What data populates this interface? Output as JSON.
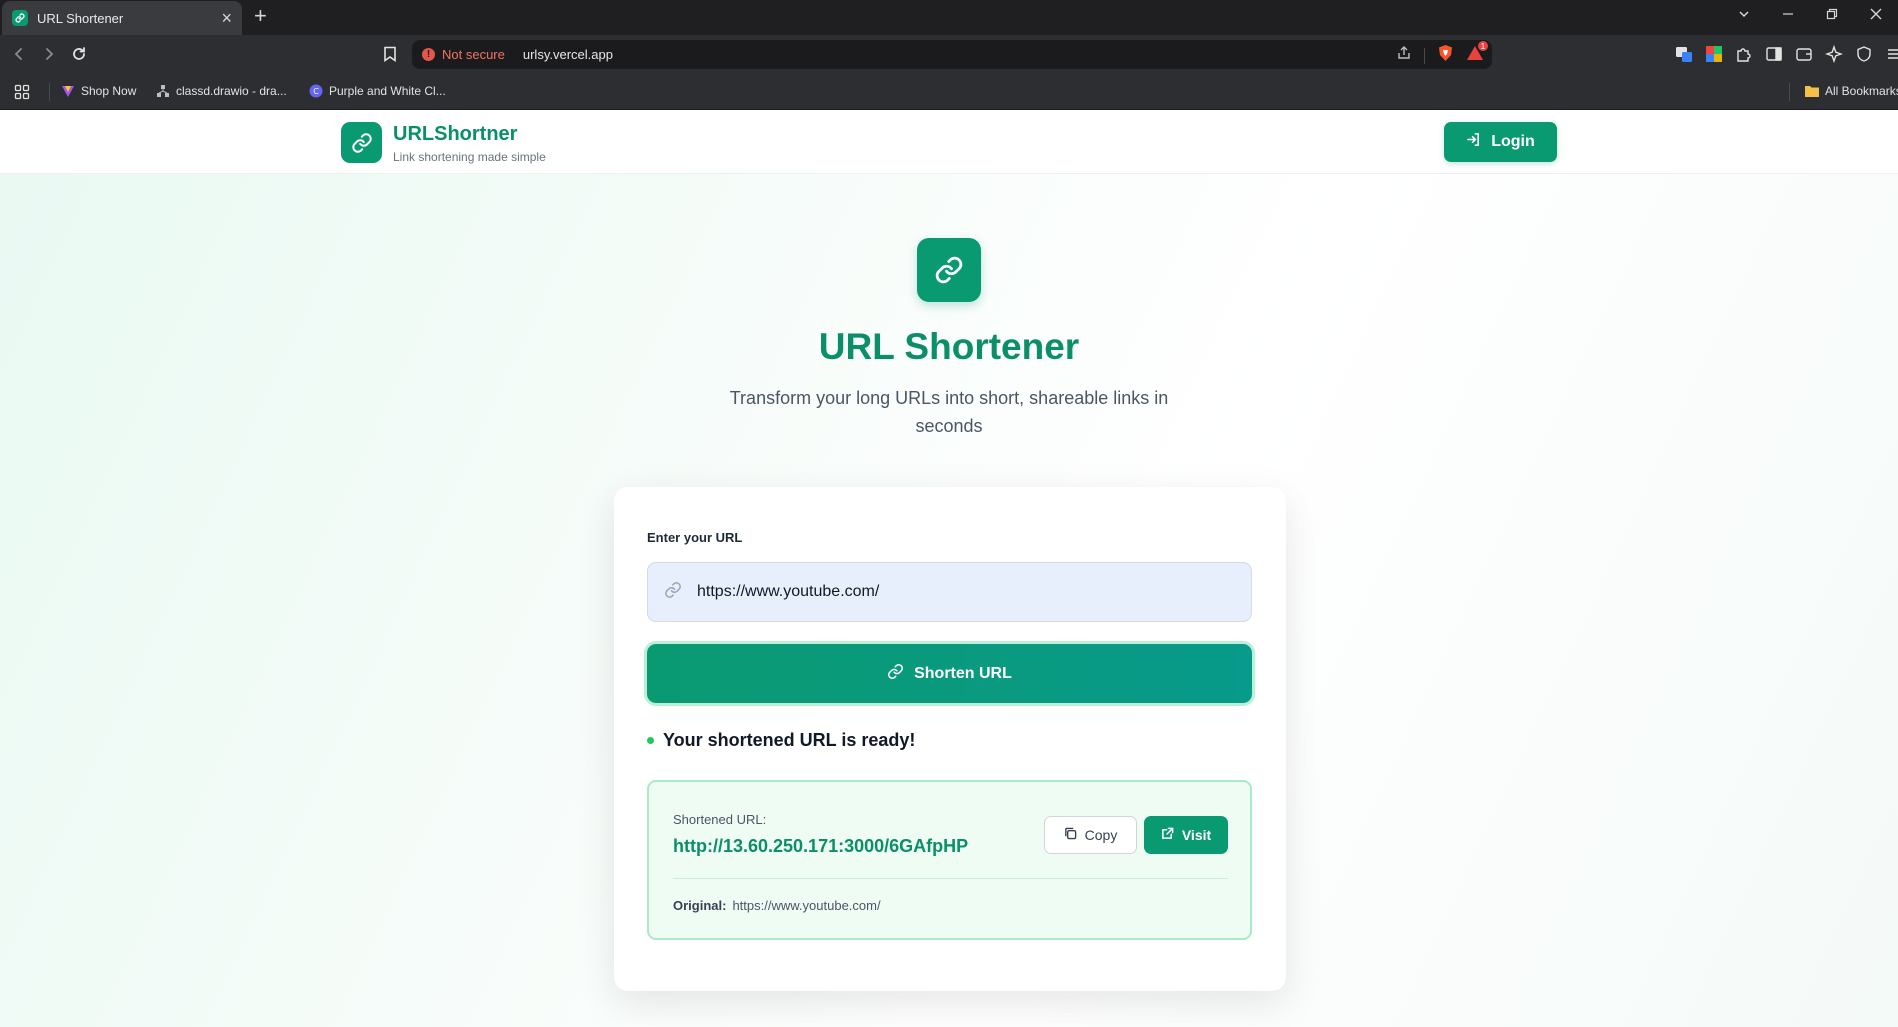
{
  "browser": {
    "tab_title": "URL Shortener",
    "security_label": "Not secure",
    "url": "urlsy.vercel.app",
    "notification_count": "1",
    "bookmarks": [
      "Shop Now",
      "classd.drawio - dra...",
      "Purple and White Cl..."
    ],
    "all_bookmarks": "All Bookmarks"
  },
  "header": {
    "brand_name": "URLShortner",
    "brand_tagline": "Link shortening made simple",
    "login_label": "Login"
  },
  "hero": {
    "title": "URL Shortener",
    "subtitle": "Transform your long URLs into short, shareable links in seconds"
  },
  "form": {
    "label": "Enter your URL",
    "url_value": "https://www.youtube.com/",
    "submit_label": "Shorten URL"
  },
  "result": {
    "heading": "Your shortened URL is ready!",
    "short_label": "Shortened URL:",
    "short_url": "http://13.60.250.171:3000/6GAfpHP",
    "copy_label": "Copy",
    "visit_label": "Visit",
    "original_label": "Original:",
    "original_url": "https://www.youtube.com/"
  },
  "colors": {
    "brand": "#0a9a72",
    "brand_text": "#0a8f68",
    "success_dot": "#22c55e",
    "result_bg": "#effcf4",
    "result_border": "#a9ebc6"
  }
}
